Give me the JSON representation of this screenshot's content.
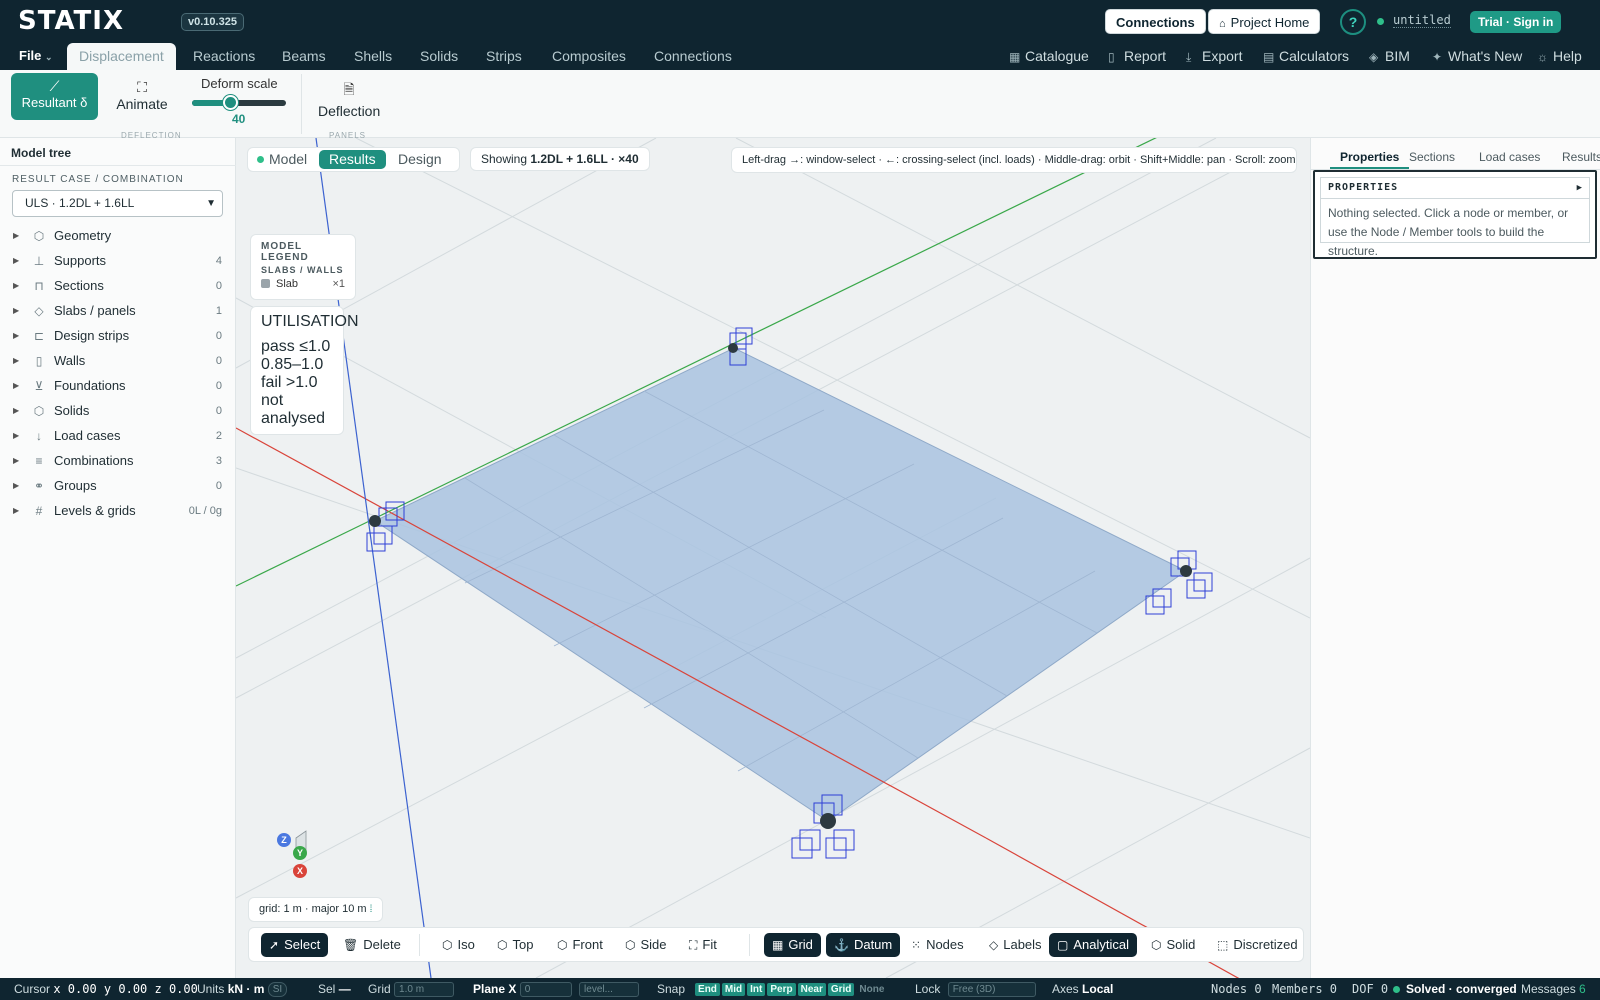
{
  "app": {
    "logo": "STATIX",
    "version": "v0.10.325",
    "connections_btn": "Connections",
    "project_home_btn": "Project Home",
    "help_btn": "?",
    "file_name": "untitled",
    "trial_btn": "Trial · Sign in"
  },
  "nav": {
    "file": "File",
    "tabs": [
      "Displacement",
      "Reactions",
      "Beams",
      "Shells",
      "Solids",
      "Strips",
      "Composites",
      "Connections"
    ],
    "active_tab": "Displacement",
    "right": [
      "Catalogue",
      "Report",
      "Export",
      "Calculators",
      "BIM",
      "What's New",
      "Help"
    ]
  },
  "ribbon": {
    "resultant_label": "Resultant δ",
    "animate_label": "Animate",
    "deform_label": "Deform scale",
    "deform_value": "40",
    "deform_fraction": 0.4,
    "deflection_label": "Deflection",
    "group_deflection": "DEFLECTION",
    "group_panels": "PANELS"
  },
  "left_panel": {
    "title": "Model tree",
    "subtitle": "RESULT CASE / COMBINATION",
    "selected_case": "ULS · 1.2DL + 1.6LL",
    "items": [
      {
        "label": "Geometry",
        "count": "",
        "icon": "cube-icon"
      },
      {
        "label": "Supports",
        "count": "4",
        "icon": "support-icon"
      },
      {
        "label": "Sections",
        "count": "0",
        "icon": "section-icon"
      },
      {
        "label": "Slabs / panels",
        "count": "1",
        "icon": "layers-icon"
      },
      {
        "label": "Design strips",
        "count": "0",
        "icon": "strip-icon"
      },
      {
        "label": "Walls",
        "count": "0",
        "icon": "wall-icon"
      },
      {
        "label": "Foundations",
        "count": "0",
        "icon": "foundation-icon"
      },
      {
        "label": "Solids",
        "count": "0",
        "icon": "solid-icon"
      },
      {
        "label": "Load cases",
        "count": "2",
        "icon": "load-icon"
      },
      {
        "label": "Combinations",
        "count": "3",
        "icon": "list-icon"
      },
      {
        "label": "Groups",
        "count": "0",
        "icon": "group-icon"
      },
      {
        "label": "Levels & grids",
        "count": "0L / 0g",
        "icon": "hash-icon"
      }
    ]
  },
  "viewport": {
    "modes": [
      "Model",
      "Results",
      "Design"
    ],
    "active_mode": "Results",
    "showing_prefix": "Showing",
    "showing_value": "1.2DL + 1.6LL · ×40",
    "hint": "Left-drag →: window-select · ←: crossing-select (incl. loads) · Middle-drag: orbit · Shift+Middle: pan · Scroll: zoom",
    "legend_title": "MODEL LEGEND",
    "legend_sub": "SLABS / WALLS",
    "legend_item": "Slab",
    "legend_count": "×1",
    "util_title": "UTILISATION",
    "util_items": [
      {
        "label": "pass ≤1.0",
        "color": "#3a9a4e"
      },
      {
        "label": "0.85–1.0",
        "color": "#d39a2a"
      },
      {
        "label": "fail >1.0",
        "color": "#c93b3b"
      },
      {
        "label": "not analysed",
        "color": "#8a9499"
      }
    ],
    "grid_info": "grid: 1 m · major 10 m",
    "axis_labels": {
      "z": "Z",
      "y": "Y",
      "x": "X"
    },
    "colors": {
      "slab": "#a9c3e0",
      "x_axis": "#d9443a",
      "y_axis": "#3aa84a",
      "z_axis": "#3c62d0",
      "support": "#2d3fd6"
    }
  },
  "bottom_toolbar": {
    "select": "Select",
    "delete": "Delete",
    "iso": "Iso",
    "top": "Top",
    "front": "Front",
    "side": "Side",
    "fit": "Fit",
    "grid": "Grid",
    "datum": "Datum",
    "nodes": "Nodes",
    "labels": "Labels",
    "analytical": "Analytical",
    "solid": "Solid",
    "discretized": "Discretized"
  },
  "right_panel": {
    "tabs": [
      "Properties",
      "Sections",
      "Load cases",
      "Results"
    ],
    "active_tab": "Properties",
    "props_title": "PROPERTIES",
    "props_text": "Nothing selected. Click a node or member, or use the Node / Member tools to build the structure."
  },
  "status": {
    "cursor_label": "Cursor",
    "cursor_value": "x 0.00 y 0.00 z 0.00",
    "units_label": "Units",
    "units_value": "kN · m",
    "units_sys": "SI",
    "sel_label": "Sel",
    "sel_value": "—",
    "grid_label": "Grid",
    "grid_value": "1.0 m",
    "plane_label": "Plane X",
    "plane_value": "0",
    "level_value": "level...",
    "snap_label": "Snap",
    "snaps": [
      "End",
      "Mid",
      "Int",
      "Perp",
      "Near",
      "Grid"
    ],
    "snap_none": "None",
    "lock_label": "Lock",
    "lock_value": "Free (3D)",
    "axes_label": "Axes",
    "axes_value": "Local",
    "nodes": "Nodes 0",
    "members": "Members 0",
    "dof": "DOF 0",
    "solved": "Solved · converged",
    "messages_label": "Messages",
    "messages_count": "6"
  }
}
